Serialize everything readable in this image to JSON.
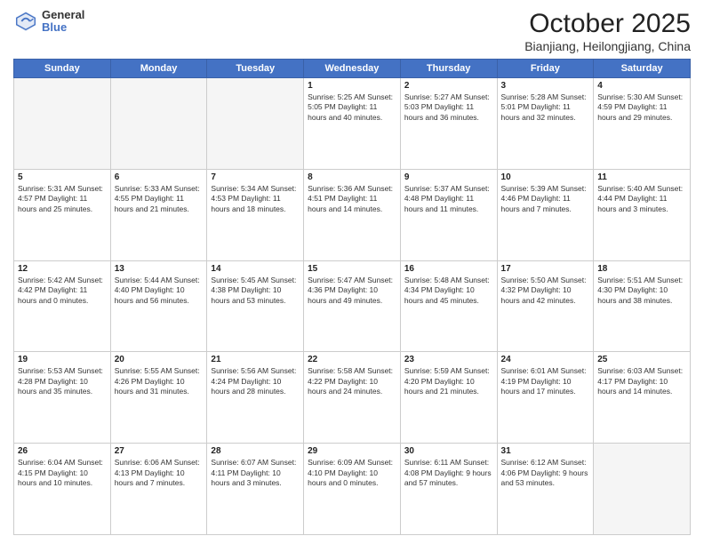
{
  "logo": {
    "general": "General",
    "blue": "Blue"
  },
  "header": {
    "month": "October 2025",
    "location": "Bianjiang, Heilongjiang, China"
  },
  "weekdays": [
    "Sunday",
    "Monday",
    "Tuesday",
    "Wednesday",
    "Thursday",
    "Friday",
    "Saturday"
  ],
  "weeks": [
    [
      {
        "day": "",
        "info": ""
      },
      {
        "day": "",
        "info": ""
      },
      {
        "day": "",
        "info": ""
      },
      {
        "day": "1",
        "info": "Sunrise: 5:25 AM\nSunset: 5:05 PM\nDaylight: 11 hours\nand 40 minutes."
      },
      {
        "day": "2",
        "info": "Sunrise: 5:27 AM\nSunset: 5:03 PM\nDaylight: 11 hours\nand 36 minutes."
      },
      {
        "day": "3",
        "info": "Sunrise: 5:28 AM\nSunset: 5:01 PM\nDaylight: 11 hours\nand 32 minutes."
      },
      {
        "day": "4",
        "info": "Sunrise: 5:30 AM\nSunset: 4:59 PM\nDaylight: 11 hours\nand 29 minutes."
      }
    ],
    [
      {
        "day": "5",
        "info": "Sunrise: 5:31 AM\nSunset: 4:57 PM\nDaylight: 11 hours\nand 25 minutes."
      },
      {
        "day": "6",
        "info": "Sunrise: 5:33 AM\nSunset: 4:55 PM\nDaylight: 11 hours\nand 21 minutes."
      },
      {
        "day": "7",
        "info": "Sunrise: 5:34 AM\nSunset: 4:53 PM\nDaylight: 11 hours\nand 18 minutes."
      },
      {
        "day": "8",
        "info": "Sunrise: 5:36 AM\nSunset: 4:51 PM\nDaylight: 11 hours\nand 14 minutes."
      },
      {
        "day": "9",
        "info": "Sunrise: 5:37 AM\nSunset: 4:48 PM\nDaylight: 11 hours\nand 11 minutes."
      },
      {
        "day": "10",
        "info": "Sunrise: 5:39 AM\nSunset: 4:46 PM\nDaylight: 11 hours\nand 7 minutes."
      },
      {
        "day": "11",
        "info": "Sunrise: 5:40 AM\nSunset: 4:44 PM\nDaylight: 11 hours\nand 3 minutes."
      }
    ],
    [
      {
        "day": "12",
        "info": "Sunrise: 5:42 AM\nSunset: 4:42 PM\nDaylight: 11 hours\nand 0 minutes."
      },
      {
        "day": "13",
        "info": "Sunrise: 5:44 AM\nSunset: 4:40 PM\nDaylight: 10 hours\nand 56 minutes."
      },
      {
        "day": "14",
        "info": "Sunrise: 5:45 AM\nSunset: 4:38 PM\nDaylight: 10 hours\nand 53 minutes."
      },
      {
        "day": "15",
        "info": "Sunrise: 5:47 AM\nSunset: 4:36 PM\nDaylight: 10 hours\nand 49 minutes."
      },
      {
        "day": "16",
        "info": "Sunrise: 5:48 AM\nSunset: 4:34 PM\nDaylight: 10 hours\nand 45 minutes."
      },
      {
        "day": "17",
        "info": "Sunrise: 5:50 AM\nSunset: 4:32 PM\nDaylight: 10 hours\nand 42 minutes."
      },
      {
        "day": "18",
        "info": "Sunrise: 5:51 AM\nSunset: 4:30 PM\nDaylight: 10 hours\nand 38 minutes."
      }
    ],
    [
      {
        "day": "19",
        "info": "Sunrise: 5:53 AM\nSunset: 4:28 PM\nDaylight: 10 hours\nand 35 minutes."
      },
      {
        "day": "20",
        "info": "Sunrise: 5:55 AM\nSunset: 4:26 PM\nDaylight: 10 hours\nand 31 minutes."
      },
      {
        "day": "21",
        "info": "Sunrise: 5:56 AM\nSunset: 4:24 PM\nDaylight: 10 hours\nand 28 minutes."
      },
      {
        "day": "22",
        "info": "Sunrise: 5:58 AM\nSunset: 4:22 PM\nDaylight: 10 hours\nand 24 minutes."
      },
      {
        "day": "23",
        "info": "Sunrise: 5:59 AM\nSunset: 4:20 PM\nDaylight: 10 hours\nand 21 minutes."
      },
      {
        "day": "24",
        "info": "Sunrise: 6:01 AM\nSunset: 4:19 PM\nDaylight: 10 hours\nand 17 minutes."
      },
      {
        "day": "25",
        "info": "Sunrise: 6:03 AM\nSunset: 4:17 PM\nDaylight: 10 hours\nand 14 minutes."
      }
    ],
    [
      {
        "day": "26",
        "info": "Sunrise: 6:04 AM\nSunset: 4:15 PM\nDaylight: 10 hours\nand 10 minutes."
      },
      {
        "day": "27",
        "info": "Sunrise: 6:06 AM\nSunset: 4:13 PM\nDaylight: 10 hours\nand 7 minutes."
      },
      {
        "day": "28",
        "info": "Sunrise: 6:07 AM\nSunset: 4:11 PM\nDaylight: 10 hours\nand 3 minutes."
      },
      {
        "day": "29",
        "info": "Sunrise: 6:09 AM\nSunset: 4:10 PM\nDaylight: 10 hours\nand 0 minutes."
      },
      {
        "day": "30",
        "info": "Sunrise: 6:11 AM\nSunset: 4:08 PM\nDaylight: 9 hours\nand 57 minutes."
      },
      {
        "day": "31",
        "info": "Sunrise: 6:12 AM\nSunset: 4:06 PM\nDaylight: 9 hours\nand 53 minutes."
      },
      {
        "day": "",
        "info": ""
      }
    ]
  ]
}
